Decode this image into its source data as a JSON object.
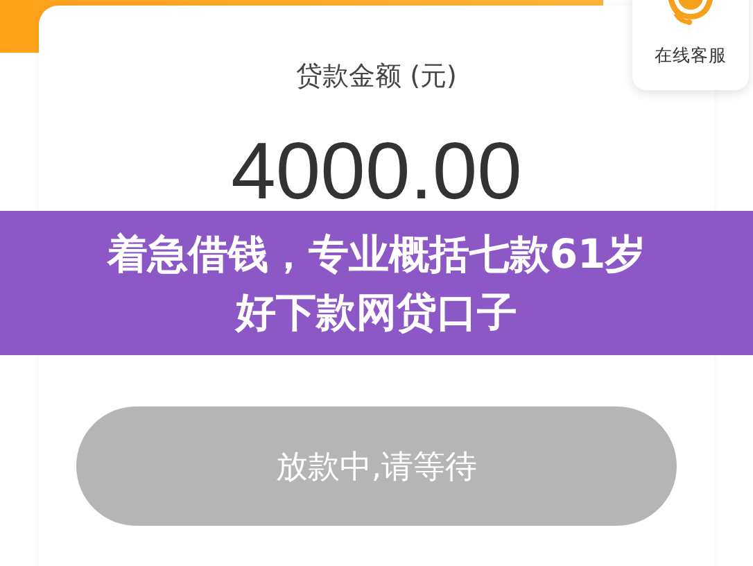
{
  "loan_card": {
    "label": "贷款金额 (元)",
    "amount": "4000.00",
    "button": {
      "label": "放款中,请等待",
      "disabled": true
    }
  },
  "service_widget": {
    "label": "在线客服"
  },
  "overlay_title": {
    "lines": [
      "着急借钱，专业概括七款61岁",
      "好下款网贷口子"
    ]
  }
}
